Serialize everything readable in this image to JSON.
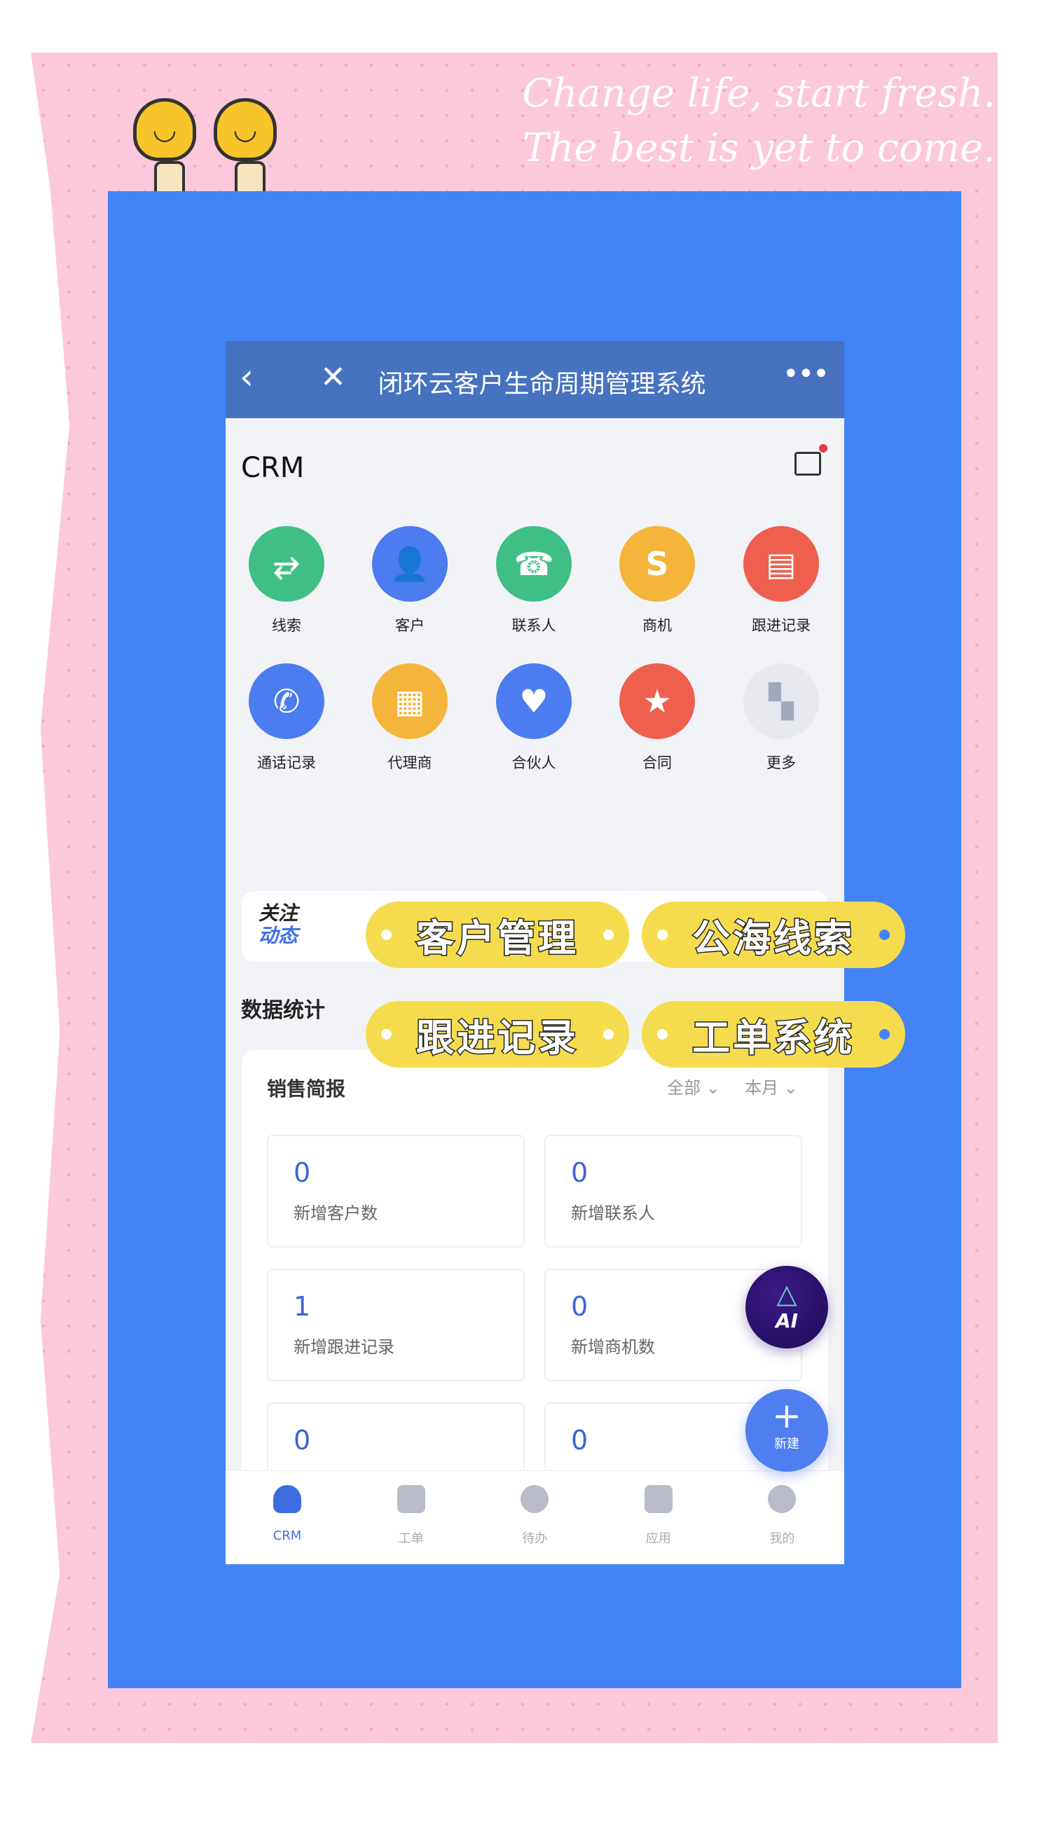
{
  "decor": {
    "slogan_line1": "Change life, start fresh.",
    "slogan_line2": "The best is yet to come."
  },
  "header": {
    "title": "闭环云客户生命周期管理系统",
    "back_icon": "chevron-left-icon",
    "close_icon": "close-icon",
    "more_icon": "more-icon"
  },
  "page": {
    "title": "CRM",
    "message_icon": "message-icon"
  },
  "modules": [
    {
      "label": "线索",
      "color": "#3fbf86",
      "glyph": "⥂"
    },
    {
      "label": "客户",
      "color": "#4b7cf0",
      "glyph": "👤"
    },
    {
      "label": "联系人",
      "color": "#3fbf86",
      "glyph": "☎"
    },
    {
      "label": "商机",
      "color": "#f5b43a",
      "glyph": "S"
    },
    {
      "label": "跟进记录",
      "color": "#ee5f4e",
      "glyph": "▤"
    },
    {
      "label": "通话记录",
      "color": "#4b7cf0",
      "glyph": "✆"
    },
    {
      "label": "代理商",
      "color": "#f5b43a",
      "glyph": "▦"
    },
    {
      "label": "合伙人",
      "color": "#4b7cf0",
      "glyph": "♥"
    },
    {
      "label": "合同",
      "color": "#ee5f4e",
      "glyph": "★"
    },
    {
      "label": "更多",
      "color": "#e6e8ee",
      "glyph": "▚"
    }
  ],
  "news": {
    "line1": "关注",
    "line2": "动态"
  },
  "stats_title": "数据统计",
  "sales": {
    "title": "销售简报",
    "filter_scope": "全部",
    "filter_period": "本月",
    "items": [
      {
        "value": "0",
        "label": "新增客户数"
      },
      {
        "value": "0",
        "label": "新增联系人"
      },
      {
        "value": "1",
        "label": "新增跟进记录"
      },
      {
        "value": "0",
        "label": "新增商机数"
      },
      {
        "value": "0",
        "label": ""
      },
      {
        "value": "0",
        "label": ""
      }
    ]
  },
  "overlay_tags": [
    "客户管理",
    "公海线索",
    "跟进记录",
    "工单系统"
  ],
  "ai_button": "AI",
  "new_button": {
    "icon": "+",
    "label": "新建"
  },
  "bottom_nav": [
    {
      "label": "CRM",
      "active": true
    },
    {
      "label": "工单"
    },
    {
      "label": "待办"
    },
    {
      "label": "应用"
    },
    {
      "label": "我的"
    }
  ],
  "colors": {
    "header": "#4672bf",
    "accent": "#3d63d8",
    "frame": "#4283f6",
    "background": "#fcc8dc",
    "tag": "#f5dc4e"
  }
}
